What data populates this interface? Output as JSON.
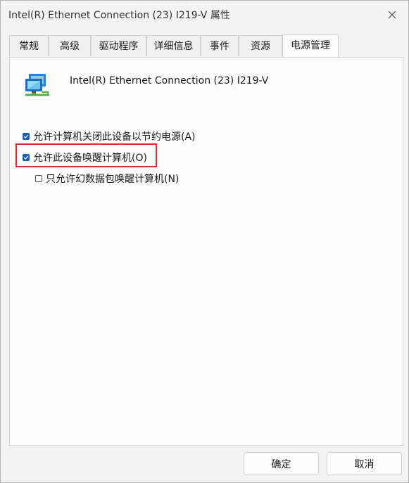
{
  "window": {
    "title": "Intel(R) Ethernet Connection (23) I219-V 属性"
  },
  "tabs": [
    {
      "label": "常规",
      "active": false
    },
    {
      "label": "高级",
      "active": false
    },
    {
      "label": "驱动程序",
      "active": false
    },
    {
      "label": "详细信息",
      "active": false
    },
    {
      "label": "事件",
      "active": false
    },
    {
      "label": "资源",
      "active": false
    },
    {
      "label": "电源管理",
      "active": true
    }
  ],
  "device": {
    "name": "Intel(R) Ethernet Connection (23) I219-V",
    "icon": "network-adapter-icon"
  },
  "options": [
    {
      "label": "允许计算机关闭此设备以节约电源(A)",
      "checked": true
    },
    {
      "label": "允许此设备唤醒计算机(O)",
      "checked": true,
      "highlighted": true
    },
    {
      "label": "只允许幻数据包唤醒计算机(N)",
      "checked": false
    }
  ],
  "buttons": {
    "ok": "确定",
    "cancel": "取消"
  },
  "colors": {
    "checkbox_checked": "#1b5fb0",
    "highlight_box": "#d32f2f"
  }
}
